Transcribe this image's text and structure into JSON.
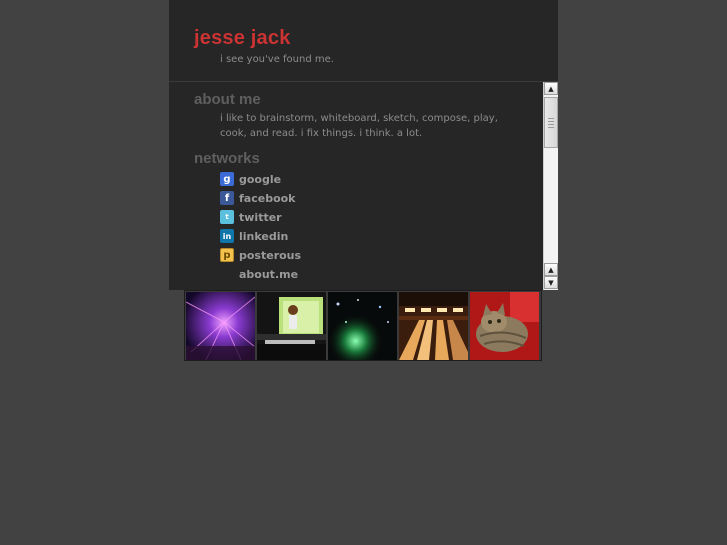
{
  "header": {
    "title": "jesse jack",
    "subtitle": "i see you've found me."
  },
  "about": {
    "heading": "about me",
    "text": "i like to brainstorm, whiteboard, sketch, compose, play, cook, and read. i fix things. i think. a lot."
  },
  "networks": {
    "heading": "networks",
    "items": [
      {
        "label": "google",
        "icon": "google-icon",
        "color": "#3b6bd6"
      },
      {
        "label": "facebook",
        "icon": "facebook-icon",
        "color": "#3b5998"
      },
      {
        "label": "twitter",
        "icon": "twitter-icon",
        "color": "#5bc0de"
      },
      {
        "label": "linkedin",
        "icon": "linkedin-icon",
        "color": "#0e76a8"
      },
      {
        "label": "posterous",
        "icon": "posterous-icon",
        "color": "#f2c24c"
      },
      {
        "label": "about.me",
        "icon": "",
        "color": ""
      }
    ]
  },
  "photos": [
    {
      "name": "concert-lights-photo"
    },
    {
      "name": "stage-performer-photo"
    },
    {
      "name": "night-green-light-photo"
    },
    {
      "name": "bowling-alley-photo"
    },
    {
      "name": "cat-photo"
    }
  ],
  "colors": {
    "accent": "#cc3333",
    "background": "#424242",
    "panel": "#262626"
  }
}
